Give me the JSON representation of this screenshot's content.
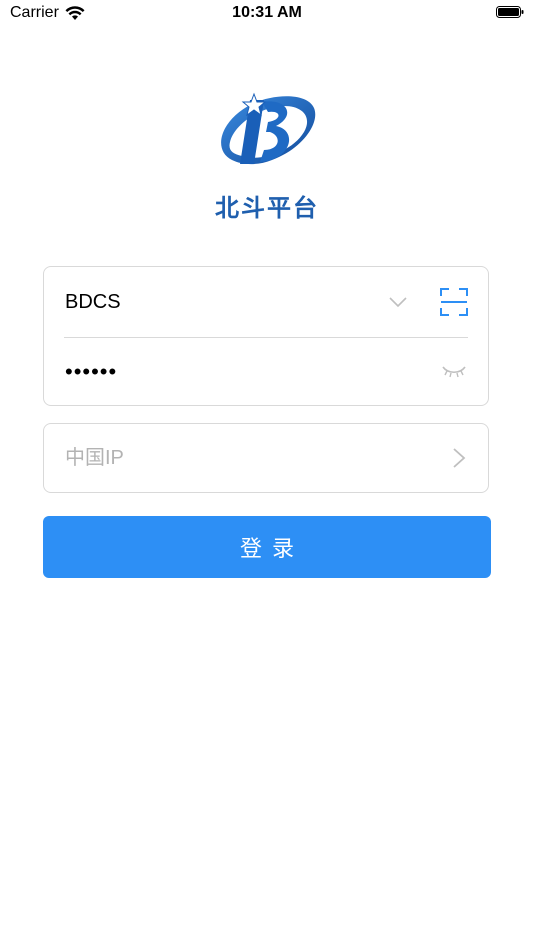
{
  "status_bar": {
    "carrier": "Carrier",
    "time": "10:31 AM"
  },
  "logo": {
    "title": "北斗平台",
    "color": "#1f5fae"
  },
  "login_form": {
    "username": "BDCS",
    "password_masked": "••••••",
    "server_placeholder": "中国IP",
    "login_label": "登录",
    "accent_color": "#2d8ff5"
  },
  "icons": {
    "wifi": "wifi-icon",
    "battery": "battery-icon",
    "dropdown": "chevron-down-icon",
    "scan": "scan-icon",
    "password_toggle": "eye-closed-icon",
    "server_select": "chevron-right-icon"
  }
}
